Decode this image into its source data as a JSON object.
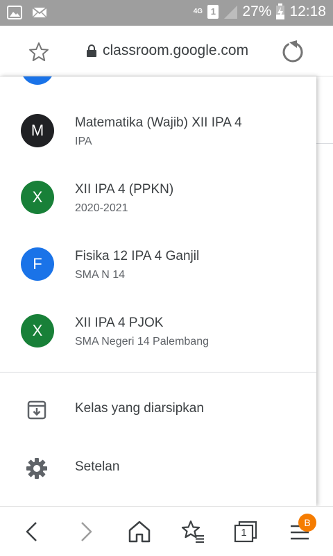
{
  "status_bar": {
    "network": "4G",
    "sim": "1",
    "battery": "27%",
    "time": "12:18"
  },
  "url_bar": {
    "url": "classroom.google.com"
  },
  "courses": [
    {
      "initial": "M",
      "title": "Matematika (Wajib) XII IPA 4",
      "subtitle": "IPA",
      "color": "#202124"
    },
    {
      "initial": "X",
      "title": "XII IPA 4 (PPKN)",
      "subtitle": "2020-2021",
      "color": "#188038"
    },
    {
      "initial": "F",
      "title": "Fisika 12 IPA 4 Ganjil",
      "subtitle": "SMA N 14",
      "color": "#1a73e8"
    },
    {
      "initial": "X",
      "title": "XII IPA 4 PJOK",
      "subtitle": "SMA Negeri 14 Palembang",
      "color": "#188038"
    }
  ],
  "menu": {
    "archived": "Kelas yang diarsipkan",
    "settings": "Setelan"
  },
  "bottom_nav": {
    "tab_count": "1",
    "menu_badge": "B"
  },
  "icons": {
    "status_left": [
      "image-icon",
      "mail-icon"
    ],
    "url": [
      "star-icon",
      "lock-icon",
      "reload-icon"
    ],
    "menu": [
      "archive-icon",
      "gear-icon"
    ],
    "bottom": [
      "back-icon",
      "forward-icon",
      "home-icon",
      "bookmarks-icon",
      "tabs-icon",
      "menu-icon"
    ]
  }
}
